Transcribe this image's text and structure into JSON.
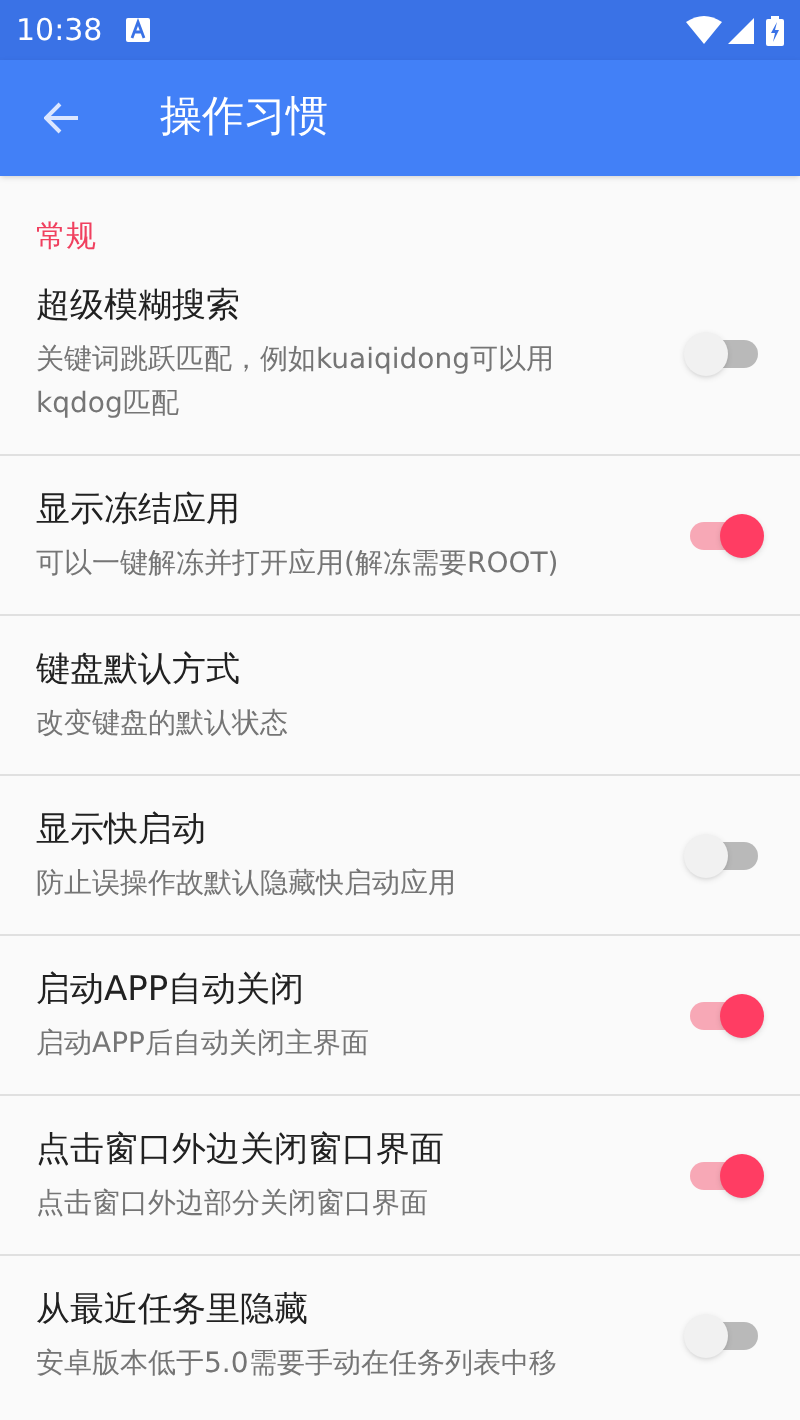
{
  "status_bar": {
    "time": "10:38"
  },
  "app_bar": {
    "title": "操作习惯"
  },
  "section": {
    "title": "常规"
  },
  "settings": [
    {
      "kind": "switch",
      "title": "超级模糊搜索",
      "summary": "关键词跳跃匹配，例如kuaiqidong可以用kqdog匹配",
      "on": false
    },
    {
      "kind": "switch",
      "title": "显示冻结应用",
      "summary": "可以一键解冻并打开应用(解冻需要ROOT)",
      "on": true
    },
    {
      "kind": "plain",
      "title": "键盘默认方式",
      "summary": "改变键盘的默认状态"
    },
    {
      "kind": "switch",
      "title": "显示快启动",
      "summary": "防止误操作故默认隐藏快启动应用",
      "on": false
    },
    {
      "kind": "switch",
      "title": "启动APP自动关闭",
      "summary": "启动APP后自动关闭主界面",
      "on": true
    },
    {
      "kind": "switch",
      "title": "点击窗口外边关闭窗口界面",
      "summary": "点击窗口外边部分关闭窗口界面",
      "on": true
    },
    {
      "kind": "switch",
      "title": "从最近任务里隐藏",
      "summary": "安卓版本低于5.0需要手动在任务列表中移",
      "on": false
    }
  ]
}
